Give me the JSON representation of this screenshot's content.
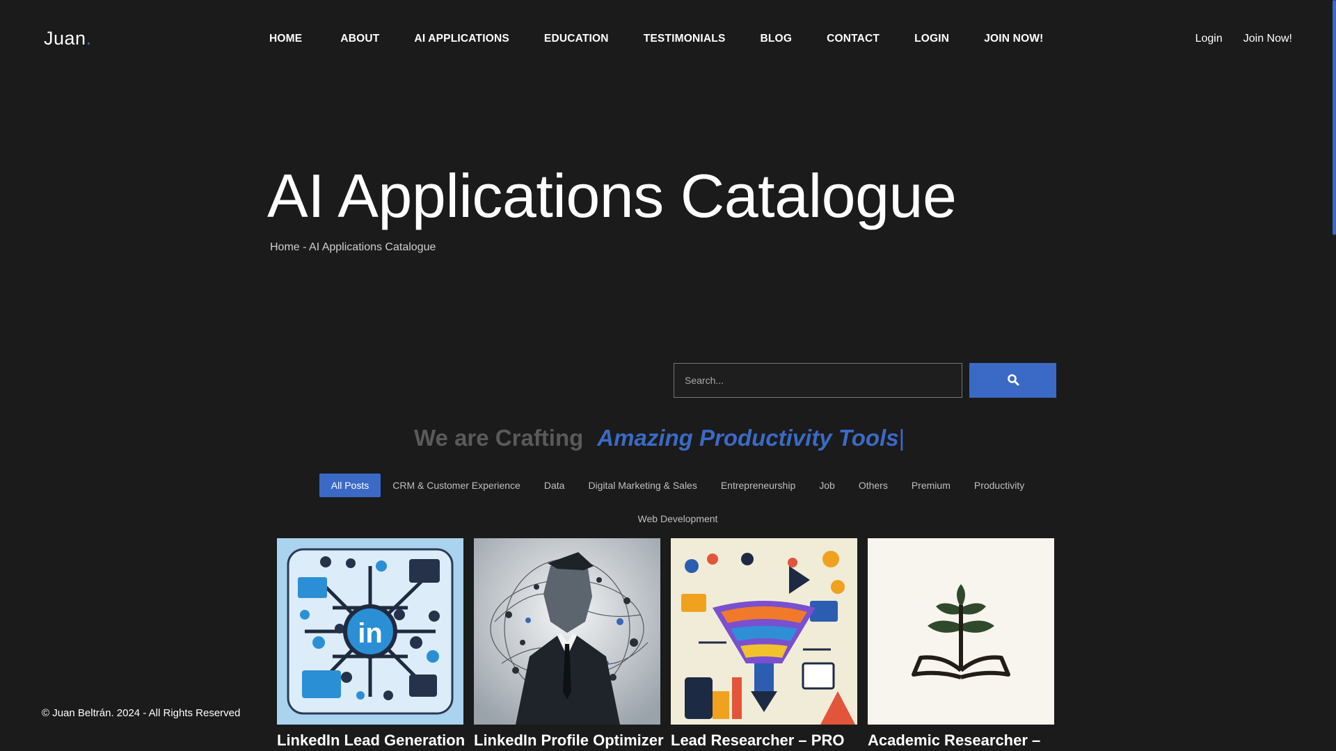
{
  "brand": {
    "name": "Juan",
    "dot": ".",
    "accent_color": "#3b6ac6"
  },
  "nav": [
    {
      "label": "HOME"
    },
    {
      "label": "ABOUT"
    },
    {
      "label": "AI APPLICATIONS"
    },
    {
      "label": "EDUCATION"
    },
    {
      "label": "TESTIMONIALS"
    },
    {
      "label": "BLOG"
    },
    {
      "label": "CONTACT"
    },
    {
      "label": "LOGIN"
    },
    {
      "label": "JOIN NOW!"
    }
  ],
  "top_right": {
    "login": "Login",
    "join": "Join Now!"
  },
  "hero": {
    "title": "AI Applications Catalogue",
    "breadcrumb_home": "Home",
    "breadcrumb_sep": " - ",
    "breadcrumb_current": "AI Applications Catalogue"
  },
  "search": {
    "placeholder": "Search...",
    "icon": "search-icon"
  },
  "tagline": {
    "prefix": "We are Crafting",
    "highlight": "Amazing Productivity Tools",
    "cursor": "|"
  },
  "filters": [
    {
      "label": "All Posts",
      "active": true
    },
    {
      "label": "CRM & Customer Experience"
    },
    {
      "label": "Data"
    },
    {
      "label": "Digital Marketing & Sales"
    },
    {
      "label": "Entrepreneurship"
    },
    {
      "label": "Job"
    },
    {
      "label": "Others"
    },
    {
      "label": "Premium"
    },
    {
      "label": "Productivity"
    },
    {
      "label": "Web Development"
    }
  ],
  "cards": [
    {
      "title": "LinkedIn Lead Generation"
    },
    {
      "title": "LinkedIn Profile Optimizer"
    },
    {
      "title": "Lead Researcher – PRO"
    },
    {
      "title": "Academic Researcher –"
    }
  ],
  "footer": {
    "copyright": "© Juan Beltrán. 2024 - All Rights Reserved"
  }
}
